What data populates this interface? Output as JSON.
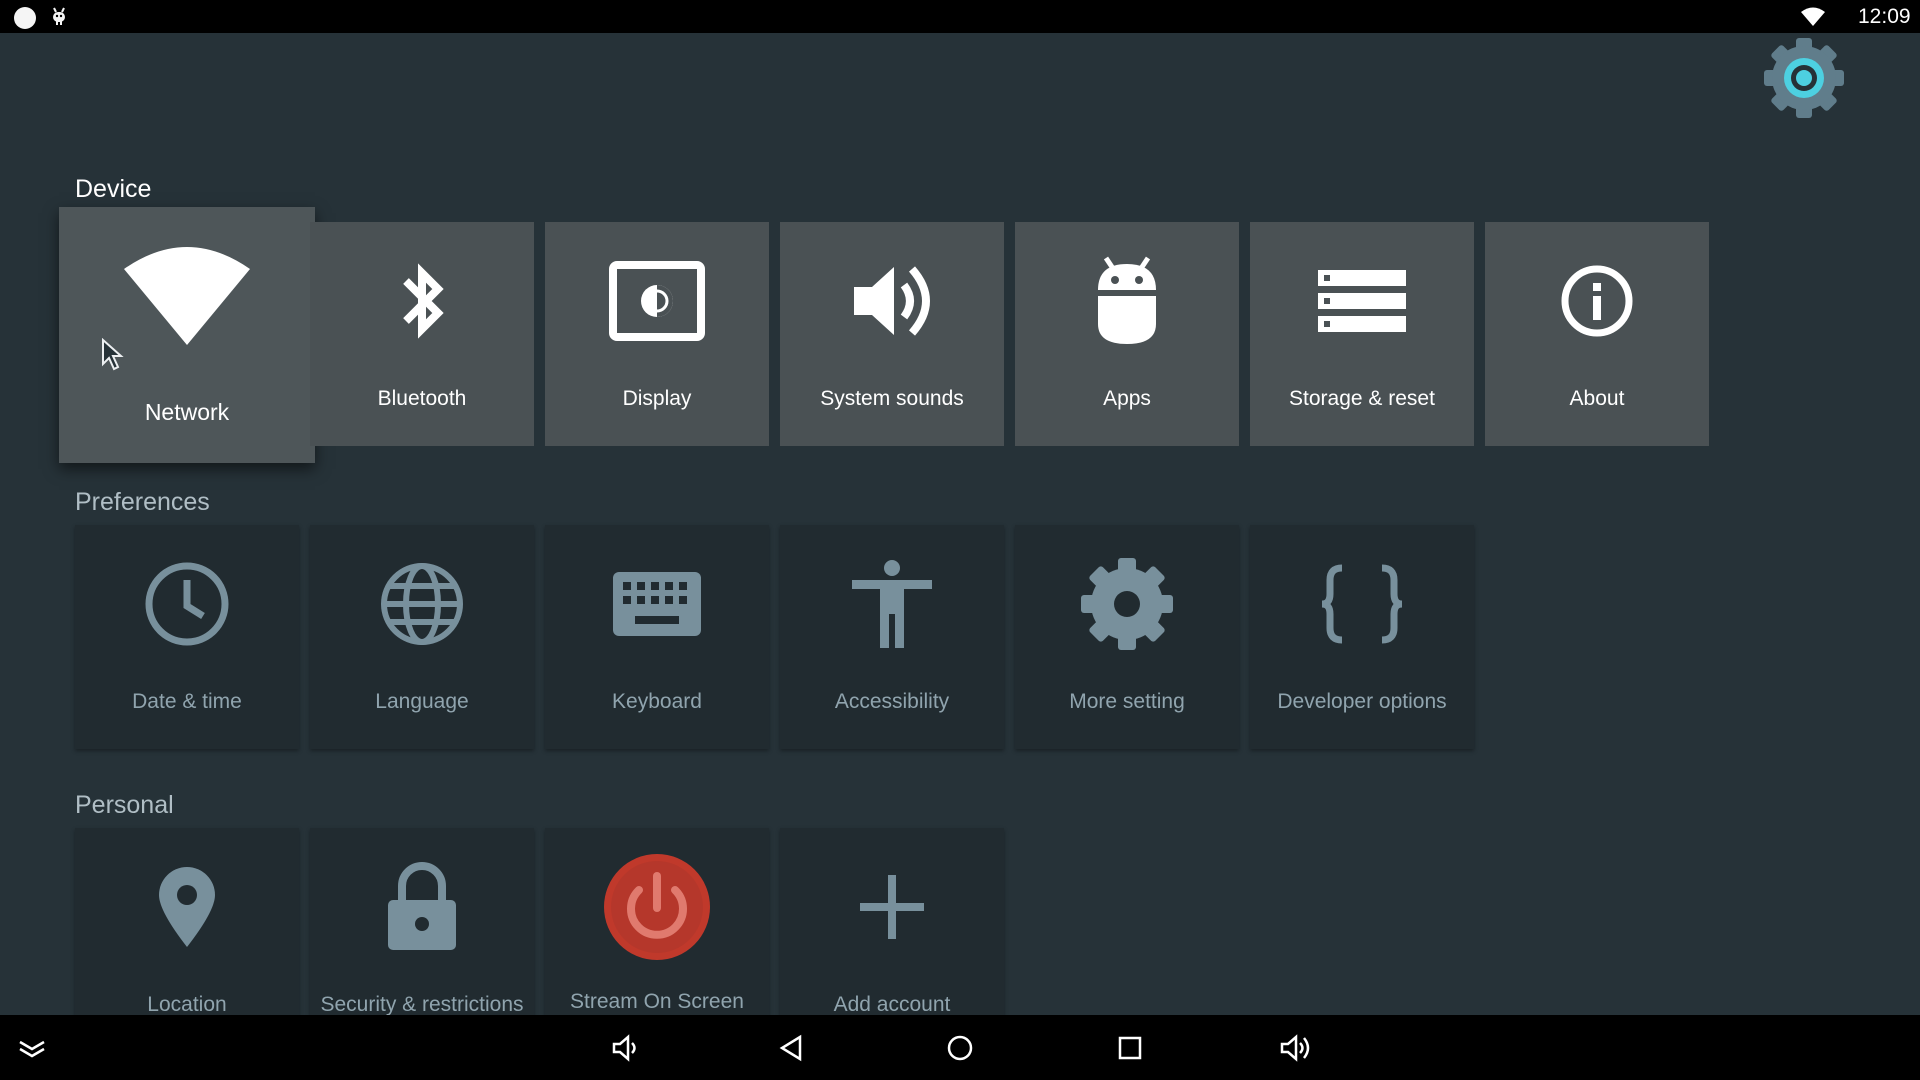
{
  "status_bar": {
    "time": "12:09"
  },
  "sections": {
    "device": "Device",
    "preferences": "Preferences",
    "personal": "Personal"
  },
  "device_tiles": [
    {
      "label": "Network",
      "icon": "wifi-icon",
      "focused": true
    },
    {
      "label": "Bluetooth",
      "icon": "bluetooth-icon"
    },
    {
      "label": "Display",
      "icon": "display-icon"
    },
    {
      "label": "System sounds",
      "icon": "speaker-icon"
    },
    {
      "label": "Apps",
      "icon": "android-icon"
    },
    {
      "label": "Storage & reset",
      "icon": "storage-icon"
    },
    {
      "label": "About",
      "icon": "info-icon"
    }
  ],
  "preference_tiles": [
    {
      "label": "Date & time",
      "icon": "clock-icon"
    },
    {
      "label": "Language",
      "icon": "globe-icon"
    },
    {
      "label": "Keyboard",
      "icon": "keyboard-icon"
    },
    {
      "label": "Accessibility",
      "icon": "accessibility-icon"
    },
    {
      "label": "More setting",
      "icon": "gear-icon"
    },
    {
      "label": "Developer options",
      "icon": "braces-icon"
    }
  ],
  "personal_tiles": [
    {
      "label": "Location",
      "icon": "location-pin-icon"
    },
    {
      "label": "Security & restrictions",
      "icon": "lock-icon"
    },
    {
      "label": "Stream On Screen",
      "icon": "power-icon",
      "accent": "#c0392b"
    },
    {
      "label": "Add account",
      "icon": "plus-icon"
    }
  ],
  "nav_bar": [
    {
      "icon": "collapse-chevron-icon"
    },
    {
      "icon": "volume-down-icon"
    },
    {
      "icon": "back-icon"
    },
    {
      "icon": "home-icon"
    },
    {
      "icon": "recents-icon"
    },
    {
      "icon": "volume-up-icon"
    }
  ],
  "colors": {
    "background": "#263238",
    "device_tile": "#4a5154",
    "pref_tile": "#212b30",
    "accent_cyan": "#4dd0e1"
  }
}
